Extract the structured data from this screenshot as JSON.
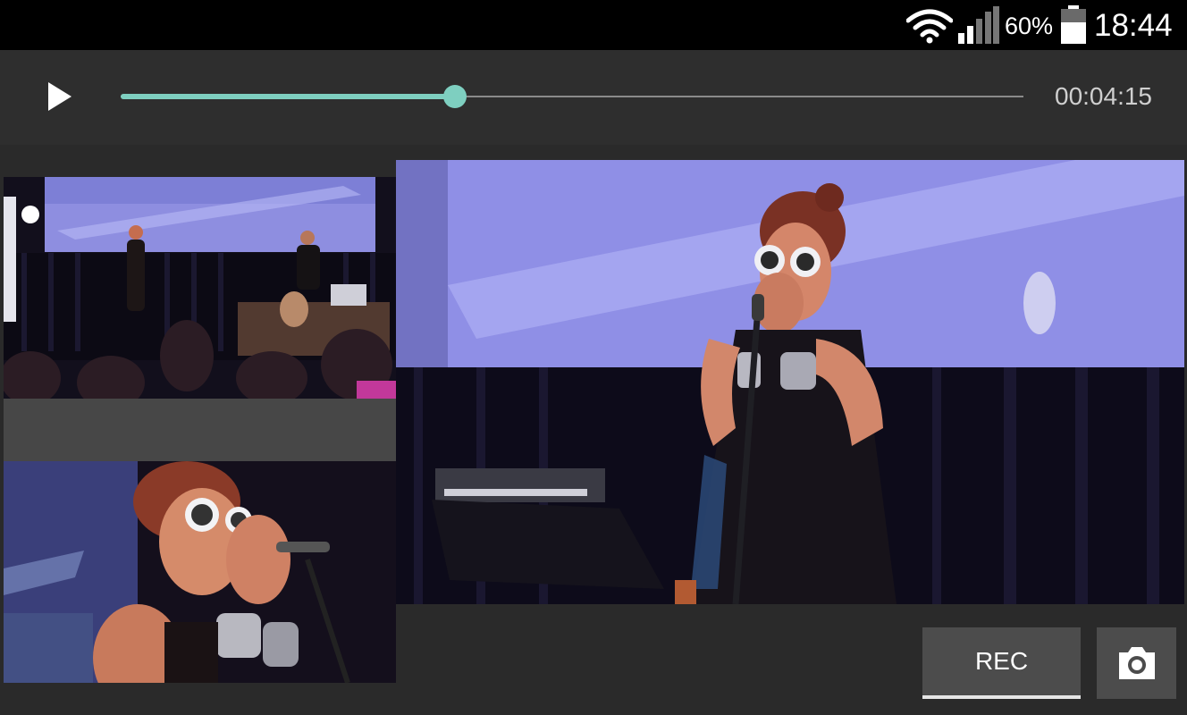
{
  "status_bar": {
    "battery_percent": "60%",
    "time": "18:44",
    "icons": [
      "wifi-icon",
      "cell-signal-icon",
      "battery-icon"
    ]
  },
  "player": {
    "play_icon": "play-icon",
    "elapsed_time": "00:04:15",
    "progress": 0.37,
    "accent_color": "#7ecfc0"
  },
  "camera_views": [
    {
      "name": "wide-stage-view"
    },
    {
      "name": "close-up-view"
    },
    {
      "name": "main-camera-view"
    }
  ],
  "controls": {
    "rec_label": "REC",
    "snapshot_icon": "camera-icon"
  }
}
